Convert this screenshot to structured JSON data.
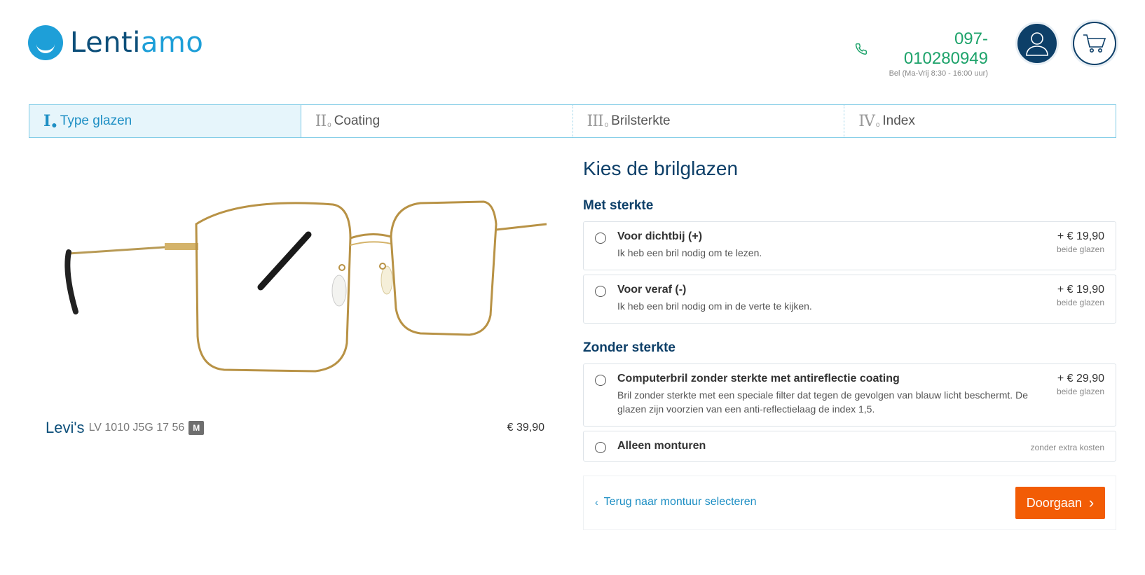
{
  "header": {
    "logo_text_part1": "Lenti",
    "logo_text_part2": "amo",
    "phone_number": "097-010280949",
    "phone_hours": "Bel (Ma-Vrij 8:30 - 16:00 uur)",
    "icons": {
      "phone": "phone-icon",
      "account": "user-icon",
      "cart": "cart-icon"
    }
  },
  "steps": [
    {
      "numeral": "I",
      "label": "Type glazen",
      "active": true
    },
    {
      "numeral": "II",
      "label": "Coating",
      "active": false
    },
    {
      "numeral": "III",
      "label": "Brilsterkte",
      "active": false
    },
    {
      "numeral": "IV",
      "label": "Index",
      "active": false
    }
  ],
  "product": {
    "brand": "Levi's",
    "model": "LV 1010 J5G 17 56",
    "size_badge": "M",
    "price": "€ 39,90"
  },
  "panel": {
    "title": "Kies de brilglazen",
    "sections": [
      {
        "heading": "Met sterkte",
        "options": [
          {
            "title": "Voor dichtbij (+)",
            "description": "Ik heb een bril nodig om te lezen.",
            "price": "+ € 19,90",
            "price_note": "beide glazen"
          },
          {
            "title": "Voor veraf (-)",
            "description": "Ik heb een bril nodig om in de verte te kijken.",
            "price": "+ € 19,90",
            "price_note": "beide glazen"
          }
        ]
      },
      {
        "heading": "Zonder sterkte",
        "options": [
          {
            "title": "Computerbril zonder sterkte met antireflectie coating",
            "description": "Bril zonder sterkte met een speciale filter dat tegen de gevolgen van blauw licht beschermt. De glazen zijn voorzien van een anti-reflectielaag de index 1,5.",
            "price": "+ € 29,90",
            "price_note": "beide glazen"
          },
          {
            "title": "Alleen monturen",
            "price_free": "zonder extra kosten"
          }
        ]
      }
    ],
    "back_label": "Terug naar montuur selecteren",
    "continue_label": "Doorgaan"
  },
  "colors": {
    "brand_blue": "#0d3f68",
    "accent_blue": "#1e9fd8",
    "phone_green": "#1ea36b",
    "cta_orange": "#f25c05"
  }
}
